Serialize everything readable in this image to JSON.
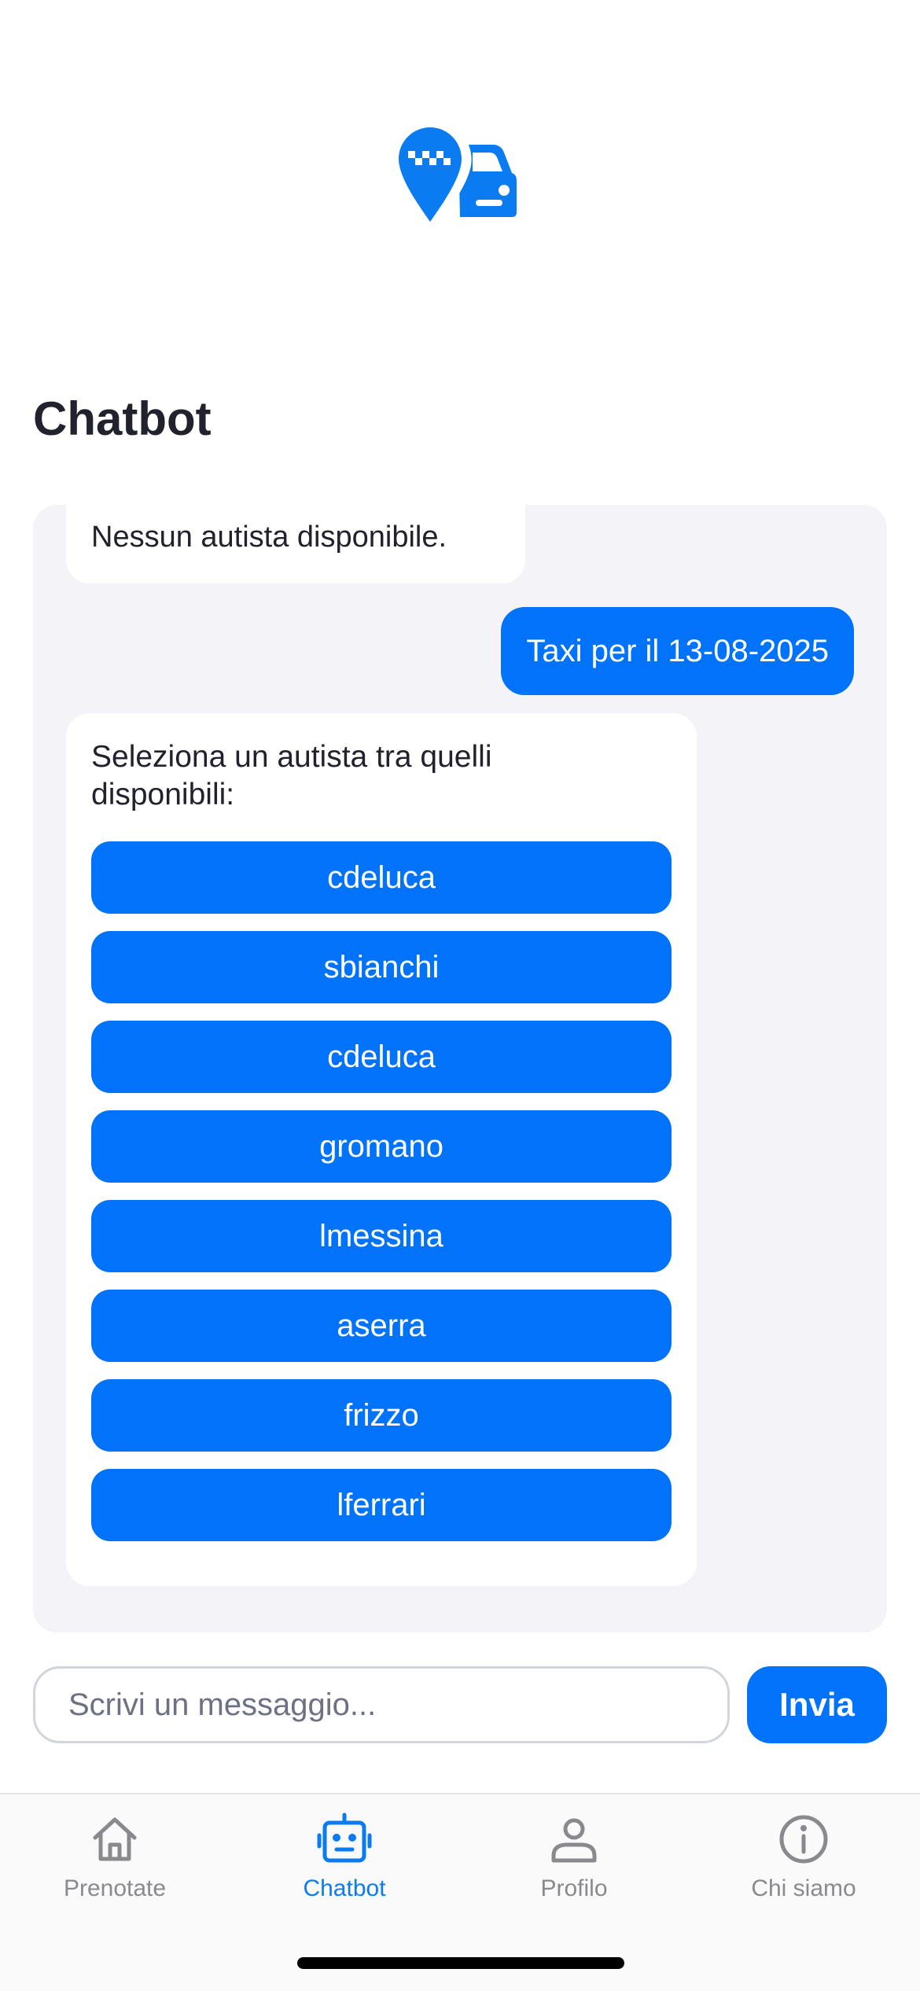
{
  "app": {
    "logo_icon": "taxi-pin-car-logo-icon",
    "title": "Chatbot",
    "accent_color": "#0073fa"
  },
  "chat": {
    "messages": [
      {
        "role": "bot",
        "text": "Nessun autista disponibile."
      },
      {
        "role": "user",
        "text": "Taxi per il 13-08-2025"
      },
      {
        "role": "bot",
        "text": "Seleziona un autista tra quelli disponibili:",
        "options": [
          "cdeluca",
          "sbianchi",
          "cdeluca",
          "gromano",
          "lmessina",
          "aserra",
          "frizzo",
          "lferrari"
        ]
      }
    ]
  },
  "composer": {
    "placeholder": "Scrivi un messaggio...",
    "value": "",
    "send_label": "Invia"
  },
  "tab_bar": {
    "items": [
      {
        "label": "Prenotate",
        "icon": "home-icon",
        "active": false
      },
      {
        "label": "Chatbot",
        "icon": "robot-icon",
        "active": true
      },
      {
        "label": "Profilo",
        "icon": "person-icon",
        "active": false
      },
      {
        "label": "Chi siamo",
        "icon": "info-icon",
        "active": false
      }
    ],
    "active_color": "#0a7bf0",
    "inactive_color": "#8a8a8e"
  }
}
